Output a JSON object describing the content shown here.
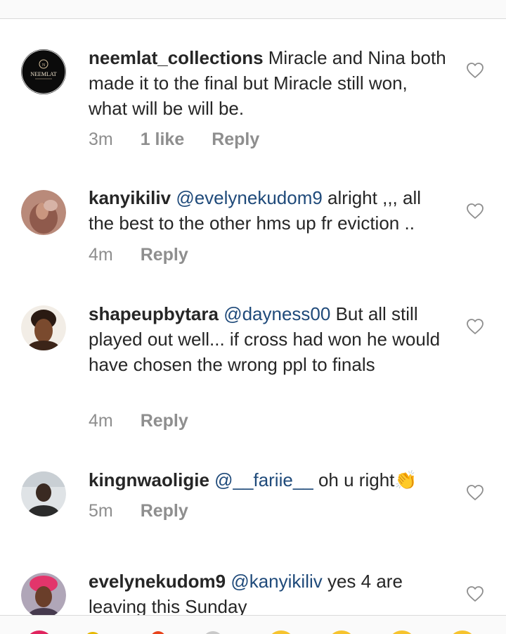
{
  "comments": [
    {
      "username": "neemlat_collections",
      "mention": "",
      "text": " Miracle and Nina both made it to the final but Miracle still won, what will be will be.",
      "time": "3m",
      "likes": "1 like",
      "reply": "Reply",
      "avatar_text": "NEEMLAT"
    },
    {
      "username": "kanyikiliv",
      "mention": "@evelynekudom9",
      "text": " alright ,,, all the best to the other hms up fr eviction ..",
      "time": "4m",
      "reply": "Reply"
    },
    {
      "username": "shapeupbytara",
      "mention": "@dayness00",
      "text": " But all still played out well... if cross had won he would have chosen the wrong ppl to finals",
      "time": "4m",
      "reply": "Reply"
    },
    {
      "username": "kingnwaoligie",
      "mention": "@__fariie__",
      "text": " oh u right👏",
      "time": "5m",
      "reply": "Reply"
    },
    {
      "username": "evelynekudom9",
      "mention": "@kanyikiliv",
      "text": " yes 4 are leaving this Sunday",
      "time": "",
      "reply": ""
    }
  ],
  "icons": {
    "like": "heart-outline-icon"
  },
  "colors": {
    "mention": "#1f4a7a",
    "meta": "#8e8e8e",
    "text": "#262626"
  }
}
